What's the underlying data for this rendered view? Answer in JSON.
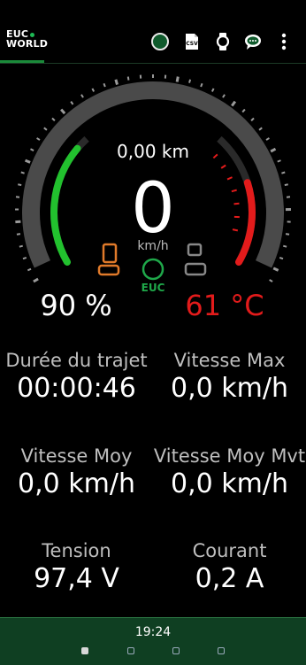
{
  "app": {
    "logo_line1": "EUC",
    "logo_line2": "WORLD"
  },
  "toolbar": {
    "connection_icon": "circle-outline-icon",
    "csv_label": "CSV",
    "watch_icon": "watch-icon",
    "chat_icon": "chat-icon",
    "more_icon": "more-vertical-icon"
  },
  "gauge": {
    "distance": "0,00 km",
    "speed": "0",
    "speed_unit": "km/h",
    "battery": "90 %",
    "battery_level": 0.9,
    "temperature": "61 °C",
    "temperature_level": 0.61,
    "euc_label": "EUC",
    "colors": {
      "battery": "#22c12e",
      "temperature": "#e21b1b",
      "accent": "#e07a2a"
    }
  },
  "stats": [
    {
      "label": "Durée du trajet",
      "value": "00:00:46"
    },
    {
      "label": "Vitesse Max",
      "value": "0,0 km/h"
    },
    {
      "label": "Vitesse Moy",
      "value": "0,0 km/h"
    },
    {
      "label": "Vitesse Moy Mvt",
      "value": "0,0 km/h"
    },
    {
      "label": "Tension",
      "value": "97,4 V"
    },
    {
      "label": "Courant",
      "value": "0,2 A"
    }
  ],
  "status_bar": {
    "time": "19:24"
  }
}
